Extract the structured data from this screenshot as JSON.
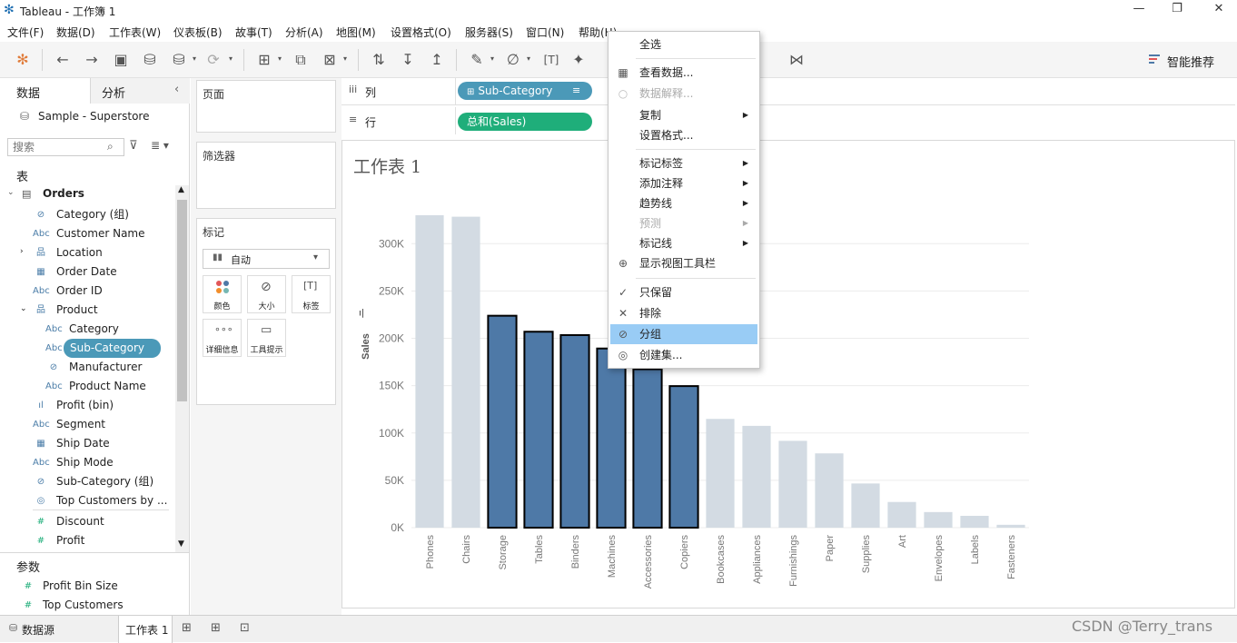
{
  "window": {
    "title": "Tableau - 工作簿 1"
  },
  "menu": [
    "文件(F)",
    "数据(D)",
    "工作表(W)",
    "仪表板(B)",
    "故事(T)",
    "分析(A)",
    "地图(M)",
    "设置格式(O)",
    "服务器(S)",
    "窗口(N)",
    "帮助(H)"
  ],
  "toolbar": {
    "recommend_label": "智能推荐"
  },
  "datapane": {
    "tab_data": "数据",
    "tab_analysis": "分析",
    "datasource": "Sample - Superstore",
    "search_placeholder": "搜索",
    "tables_label": "表",
    "table_name": "Orders",
    "fields": [
      {
        "name": "Category (组)",
        "icon": "paperclip-icon"
      },
      {
        "name": "Customer Name",
        "icon": "Abc"
      },
      {
        "name": "Location",
        "icon": "hierarchy-icon"
      },
      {
        "name": "Order Date",
        "icon": "calendar-icon"
      },
      {
        "name": "Order ID",
        "icon": "Abc"
      },
      {
        "name": "Product",
        "icon": "hierarchy-icon"
      },
      {
        "name": "Category",
        "icon": "Abc"
      },
      {
        "name": "Sub-Category",
        "icon": "Abc"
      },
      {
        "name": "Manufacturer",
        "icon": "paperclip-icon"
      },
      {
        "name": "Product Name",
        "icon": "Abc"
      },
      {
        "name": "Profit (bin)",
        "icon": "bin-icon"
      },
      {
        "name": "Segment",
        "icon": "Abc"
      },
      {
        "name": "Ship Date",
        "icon": "calendar-icon"
      },
      {
        "name": "Ship Mode",
        "icon": "Abc"
      },
      {
        "name": "Sub-Category (组)",
        "icon": "paperclip-icon"
      },
      {
        "name": "Top Customers by ...",
        "icon": "set-icon"
      },
      {
        "name": "Discount",
        "icon": "#"
      },
      {
        "name": "Profit",
        "icon": "#"
      }
    ],
    "params_label": "参数",
    "params": [
      {
        "name": "Profit Bin Size",
        "icon": "#"
      },
      {
        "name": "Top Customers",
        "icon": "#"
      }
    ]
  },
  "shelves": {
    "pages": "页面",
    "filters": "筛选器",
    "marks": "标记",
    "marks_type": "自动",
    "marks_buttons": [
      "颜色",
      "大小",
      "标签",
      "详细信息",
      "工具提示"
    ],
    "columns_label": "列",
    "rows_label": "行",
    "columns_pill": "Sub-Category",
    "rows_pill": "总和(Sales)"
  },
  "sheet": {
    "title": "工作表 1",
    "ylabel": "Sales"
  },
  "chart_data": {
    "type": "bar",
    "title": "工作表 1",
    "ylabel": "Sales",
    "xlabel": "",
    "ylim": [
      0,
      330000
    ],
    "yticks": [
      "0K",
      "50K",
      "100K",
      "150K",
      "200K",
      "250K",
      "300K"
    ],
    "ytick_values": [
      0,
      50000,
      100000,
      150000,
      200000,
      250000,
      300000
    ],
    "grid": true,
    "categories": [
      "Phones",
      "Chairs",
      "Storage",
      "Tables",
      "Binders",
      "Machines",
      "Accessories",
      "Copiers",
      "Bookcases",
      "Appliances",
      "Furnishings",
      "Paper",
      "Supplies",
      "Art",
      "Envelopes",
      "Labels",
      "Fasteners"
    ],
    "values": [
      330007,
      328449,
      223844,
      206966,
      203413,
      189239,
      167380,
      149528,
      114880,
      107532,
      91705,
      78479,
      46674,
      27119,
      16476,
      12486,
      3024
    ],
    "selected": [
      false,
      false,
      true,
      true,
      true,
      true,
      true,
      true,
      false,
      false,
      false,
      false,
      false,
      false,
      false,
      false,
      false
    ],
    "colors": {
      "selected": "#4e79a7",
      "unselected": "#d3dbe3"
    }
  },
  "context_menu": {
    "items": [
      {
        "label": "全选",
        "icon": "",
        "arrow": false,
        "disabled": false
      },
      {
        "label": "查看数据...",
        "icon": "table-icon",
        "arrow": false,
        "disabled": false
      },
      {
        "label": "数据解释...",
        "icon": "lightbulb-icon",
        "arrow": false,
        "disabled": true
      },
      {
        "label": "复制",
        "icon": "",
        "arrow": true,
        "disabled": false
      },
      {
        "label": "设置格式...",
        "icon": "",
        "arrow": false,
        "disabled": false
      },
      {
        "label": "标记标签",
        "icon": "",
        "arrow": true,
        "disabled": false
      },
      {
        "label": "添加注释",
        "icon": "",
        "arrow": true,
        "disabled": false
      },
      {
        "label": "趋势线",
        "icon": "",
        "arrow": true,
        "disabled": false
      },
      {
        "label": "预测",
        "icon": "",
        "arrow": true,
        "disabled": true
      },
      {
        "label": "标记线",
        "icon": "",
        "arrow": true,
        "disabled": false
      },
      {
        "label": "显示视图工具栏",
        "icon": "zoom-icon",
        "arrow": false,
        "disabled": false
      },
      {
        "label": "只保留",
        "icon": "check-icon",
        "arrow": false,
        "disabled": false
      },
      {
        "label": "排除",
        "icon": "x-icon",
        "arrow": false,
        "disabled": false
      },
      {
        "label": "分组",
        "icon": "paperclip-icon",
        "arrow": false,
        "disabled": false,
        "highlighted": true
      },
      {
        "label": "创建集...",
        "icon": "set-icon",
        "arrow": false,
        "disabled": false
      }
    ]
  },
  "bottom": {
    "datasource_tab": "数据源",
    "sheet_tab": "工作表 1",
    "watermark": "CSDN @Terry_trans"
  }
}
